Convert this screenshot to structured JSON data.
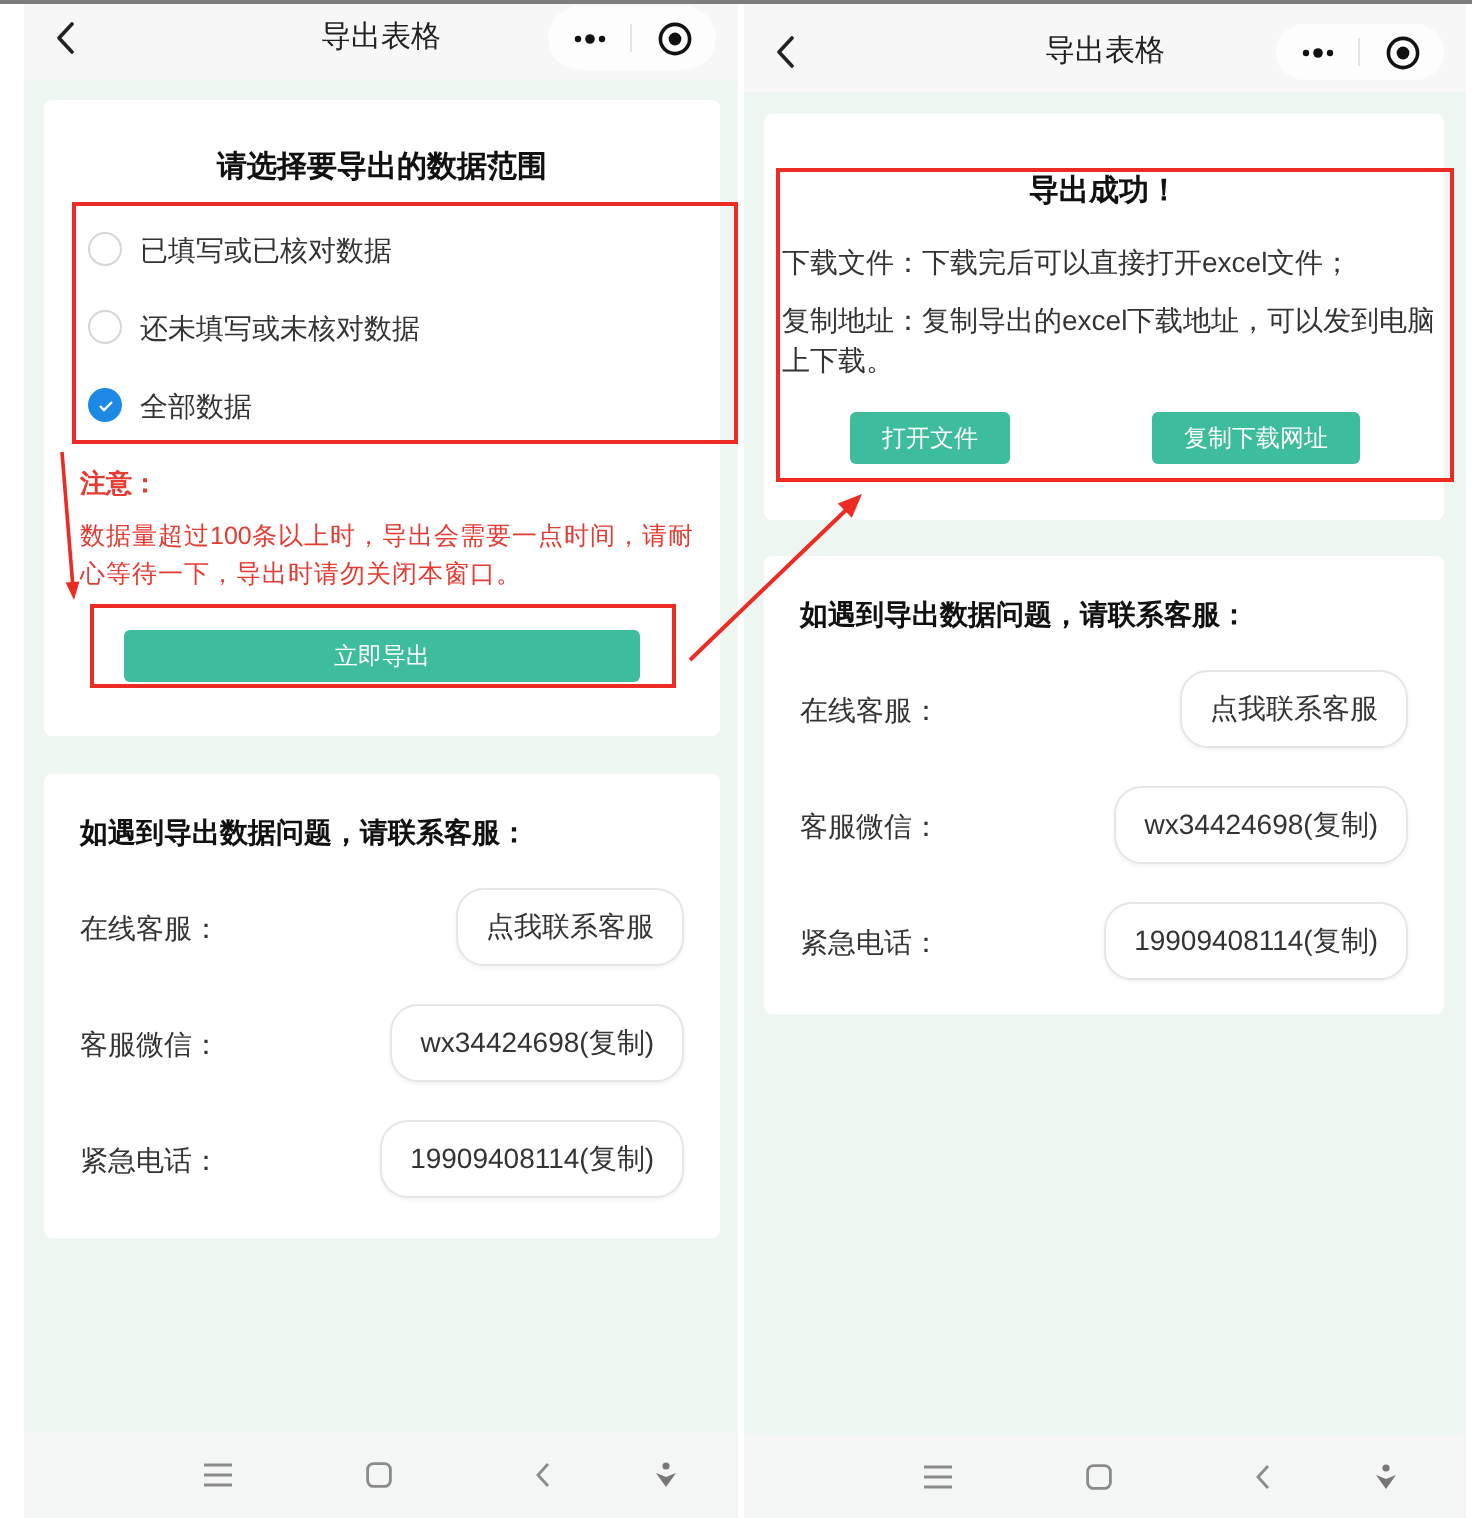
{
  "screens": [
    {
      "header": {
        "title": "导出表格"
      },
      "cards": [
        {
          "kind": "range",
          "title": "请选择要导出的数据范围",
          "options": [
            {
              "label": "已填写或已核对数据",
              "selected": false
            },
            {
              "label": "还未填写或未核对数据",
              "selected": false
            },
            {
              "label": "全部数据",
              "selected": true
            }
          ],
          "note": {
            "title": "注意：",
            "text": "数据量超过100条以上时，导出会需要一点时间，请耐心等待一下，导出时请勿关闭本窗口。"
          },
          "button": "立即导出"
        },
        {
          "kind": "contact",
          "title": "如遇到导出数据问题，请联系客服：",
          "rows": [
            {
              "label": "在线客服：",
              "action": "点我联系客服"
            },
            {
              "label": "客服微信：",
              "action": "wx34424698(复制)"
            },
            {
              "label": "紧急电话：",
              "action": "19909408114(复制)"
            }
          ]
        }
      ]
    },
    {
      "header": {
        "title": "导出表格"
      },
      "cards": [
        {
          "kind": "success",
          "title": "导出成功！",
          "paragraphs": [
            "下载文件：下载完后可以直接打开excel文件；",
            "复制地址：复制导出的excel下载地址，可以发到电脑上下载。"
          ],
          "buttons": [
            "打开文件",
            "复制下载网址"
          ]
        },
        {
          "kind": "contact",
          "title": "如遇到导出数据问题，请联系客服：",
          "rows": [
            {
              "label": "在线客服：",
              "action": "点我联系客服"
            },
            {
              "label": "客服微信：",
              "action": "wx34424698(复制)"
            },
            {
              "label": "紧急电话：",
              "action": "19909408114(复制)"
            }
          ]
        }
      ]
    }
  ]
}
